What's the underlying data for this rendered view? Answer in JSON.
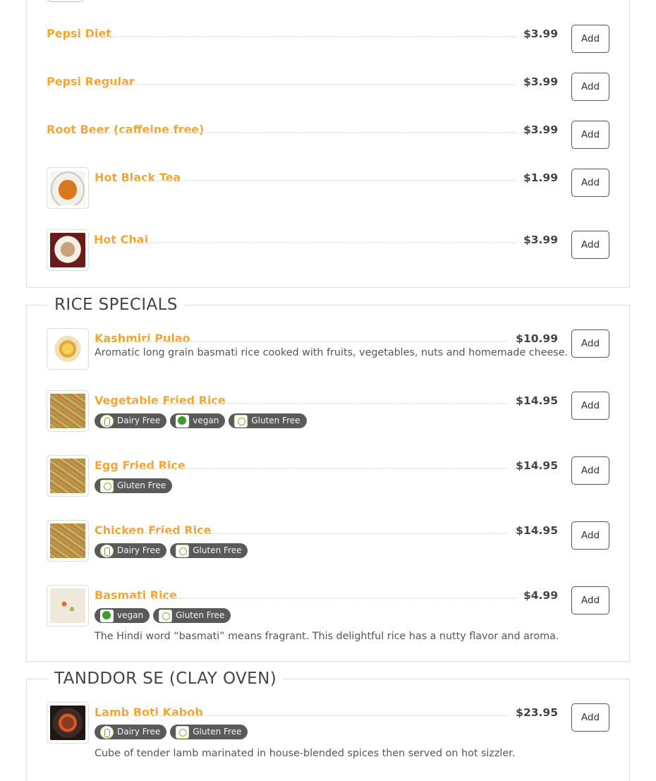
{
  "sections": [
    {
      "title": "",
      "items": [
        {
          "name": "Pepsi Diet",
          "price": "$3.99",
          "add": "Add"
        },
        {
          "name": "Pepsi Regular",
          "price": "$3.99",
          "add": "Add"
        },
        {
          "name": "Root Beer (caffeine free)",
          "price": "$3.99",
          "add": "Add"
        },
        {
          "name": "Hot Black Tea",
          "price": "$1.99",
          "add": "Add",
          "image_icon": "tea-cup-photo"
        },
        {
          "name": "Hot Chai",
          "price": "$3.99",
          "add": "Add",
          "image_icon": "chai-cup-photo"
        }
      ]
    },
    {
      "title": "RICE SPECIALS",
      "items": [
        {
          "name": "Kashmiri Pulao",
          "price": "$10.99",
          "add": "Add",
          "description": "Aromatic long grain basmati rice cooked with fruits, vegetables, nuts and homemade cheese.",
          "image_icon": "pulao-photo"
        },
        {
          "name": "Vegetable Fried Rice",
          "price": "$14.95",
          "add": "Add",
          "tags": [
            "Dairy Free",
            "vegan",
            "Gluten Free"
          ],
          "image_icon": "fried-rice-photo"
        },
        {
          "name": "Egg Fried Rice",
          "price": "$14.95",
          "add": "Add",
          "tags": [
            "Gluten Free"
          ],
          "image_icon": "fried-rice-photo"
        },
        {
          "name": "Chicken Fried Rice",
          "price": "$14.95",
          "add": "Add",
          "tags": [
            "Dairy Free",
            "Gluten Free"
          ],
          "image_icon": "fried-rice-photo"
        },
        {
          "name": "Basmati Rice",
          "price": "$4.99",
          "add": "Add",
          "tags": [
            "vegan",
            "Gluten Free"
          ],
          "description": "The Hindi word “basmati” means fragrant. This delightful rice has a nutty flavor and aroma.",
          "image_icon": "basmati-rice-photo"
        }
      ]
    },
    {
      "title": "TANDDOR SE (CLAY OVEN)",
      "items": [
        {
          "name": "Lamb Boti Kabob",
          "price": "$23.95",
          "add": "Add",
          "tags": [
            "Dairy Free",
            "Gluten Free"
          ],
          "description": "Cube of tender lamb marinated in house-blended spices then served on hot sizzler.",
          "image_icon": "lamb-kabob-photo"
        }
      ]
    }
  ],
  "colors": {
    "item_name": "#f2a638",
    "tag_bg": "#5a5a5a",
    "border": "#dcdcdc"
  }
}
